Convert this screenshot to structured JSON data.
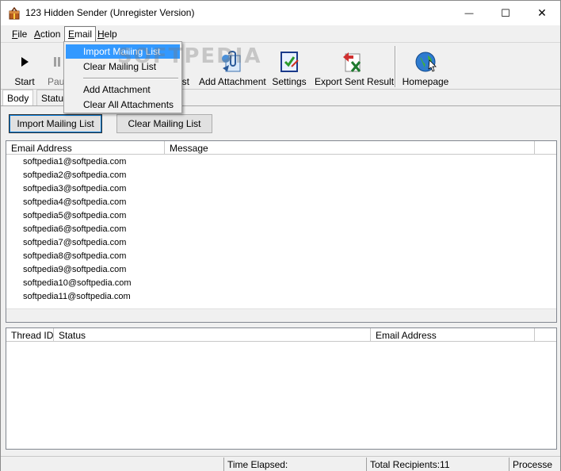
{
  "window": {
    "title": "123 Hidden Sender (Unregister Version)",
    "minimize_glyph": "—",
    "maximize_glyph": "☐",
    "close_glyph": "✕"
  },
  "menubar": {
    "items": [
      {
        "label": "File",
        "accel": "F",
        "rest": "ile"
      },
      {
        "label": "Action",
        "accel": "A",
        "rest": "ction"
      },
      {
        "label": "Email",
        "accel": "E",
        "rest": "mail"
      },
      {
        "label": "Help",
        "accel": "H",
        "rest": "elp"
      }
    ]
  },
  "email_menu": {
    "items": [
      {
        "label": "Import Mailing List"
      },
      {
        "label": "Clear Mailing List"
      },
      {
        "label": "Add Attachment"
      },
      {
        "label": "Clear All Attachments"
      }
    ]
  },
  "toolbar": {
    "start_label": "Start",
    "pause_label": "Pau",
    "import_label_tail": "st",
    "add_attachment_label": "Add Attachment",
    "settings_label": "Settings",
    "export_label": "Export Sent Result",
    "homepage_label": "Homepage",
    "icons": {
      "start": "play-icon",
      "pause": "pause-icon",
      "add_attachment": "attachment-icon",
      "settings": "settings-icon",
      "export": "excel-export-icon",
      "homepage": "globe-icon"
    }
  },
  "tabs": [
    {
      "label": "Body"
    },
    {
      "label": "Status"
    }
  ],
  "panel": {
    "import_button": "Import Mailing List",
    "clear_button": "Clear Mailing List"
  },
  "email_list": {
    "columns": [
      "Email Address",
      "Message"
    ],
    "rows": [
      "softpedia1@softpedia.com",
      "softpedia2@softpedia.com",
      "softpedia3@softpedia.com",
      "softpedia4@softpedia.com",
      "softpedia5@softpedia.com",
      "softpedia6@softpedia.com",
      "softpedia7@softpedia.com",
      "softpedia8@softpedia.com",
      "softpedia9@softpedia.com",
      "softpedia10@softpedia.com",
      "softpedia11@softpedia.com"
    ]
  },
  "thread_list": {
    "columns": [
      "Thread ID",
      "Status",
      "Email Address"
    ]
  },
  "statusbar": {
    "time_elapsed": "Time Elapsed:",
    "total_recipients": "Total Recipients:11",
    "process": "Processe"
  },
  "watermark": "SOFTPEDIA",
  "colors": {
    "menu_highlight": "#3399ff",
    "window_bg": "#f0f0f0"
  }
}
